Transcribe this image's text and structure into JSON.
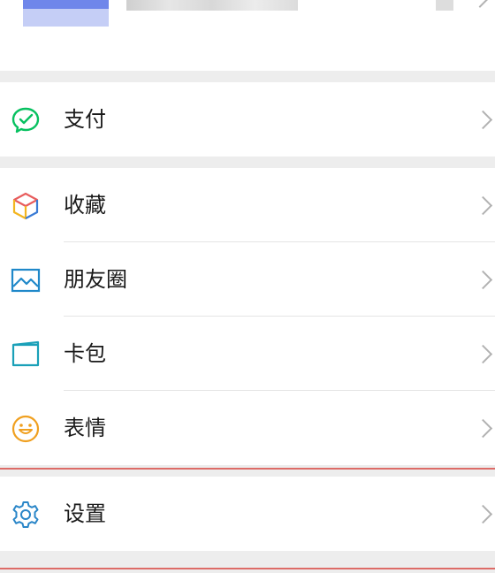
{
  "menu": {
    "pay": {
      "label": "支付",
      "icon": "wechat-pay-icon",
      "color": "#07c160"
    },
    "collections": {
      "label": "收藏",
      "icon": "cube-icon"
    },
    "moments": {
      "label": "朋友圈",
      "icon": "picture-icon",
      "color": "#1f88c9"
    },
    "cards": {
      "label": "卡包",
      "icon": "card-icon",
      "color": "#1aa0b8"
    },
    "stickers": {
      "label": "表情",
      "icon": "smiley-icon",
      "color": "#f0a020"
    },
    "settings": {
      "label": "设置",
      "icon": "gear-icon",
      "color": "#2a86c8"
    }
  },
  "colors": {
    "background": "#ededed",
    "row": "#ffffff",
    "chevron": "#b2b2b2",
    "highlight": "#d9534f"
  }
}
